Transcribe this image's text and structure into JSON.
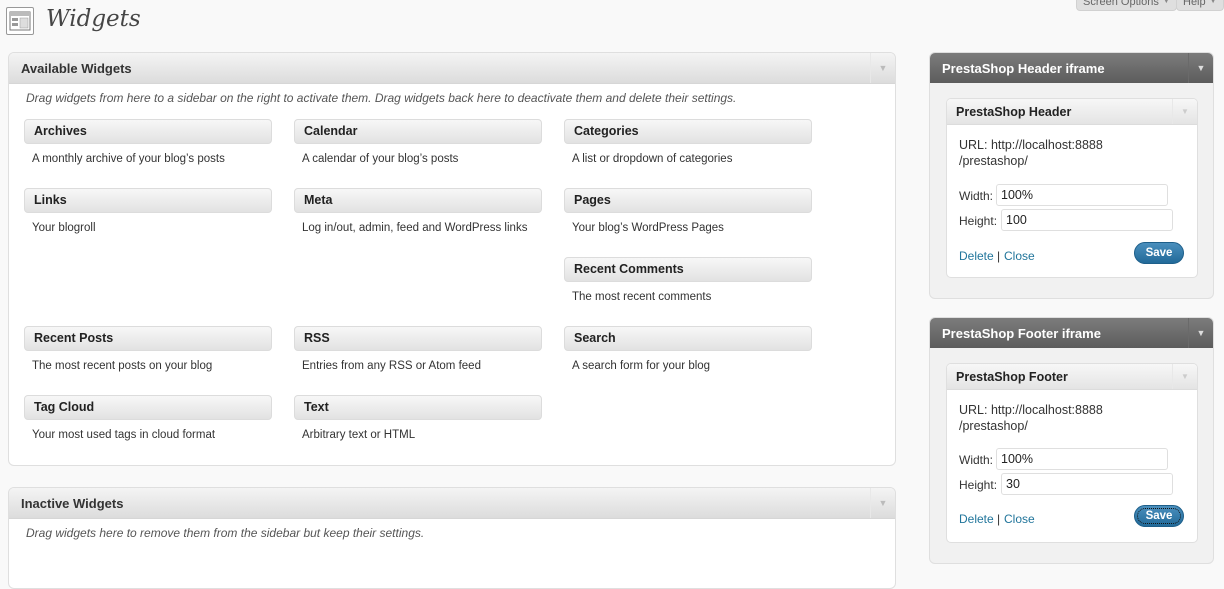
{
  "top_tabs": {
    "screen_options": "Screen Options",
    "help": "Help"
  },
  "page": {
    "title": "Widgets",
    "icon": "widgets-icon"
  },
  "available": {
    "title": "Available Widgets",
    "description": "Drag widgets from here to a sidebar on the right to activate them. Drag widgets back here to deactivate them and delete their settings.",
    "widgets": [
      {
        "title": "Archives",
        "desc": "A monthly archive of your blog’s posts"
      },
      {
        "title": "Calendar",
        "desc": "A calendar of your blog’s posts"
      },
      {
        "title": "Categories",
        "desc": "A list or dropdown of categories"
      },
      {
        "title": "Links",
        "desc": "Your blogroll"
      },
      {
        "title": "Meta",
        "desc": "Log in/out, admin, feed and WordPress links"
      },
      {
        "title": "Pages",
        "desc": "Your blog’s WordPress Pages"
      },
      {
        "title": "Recent Comments",
        "desc": "The most recent comments"
      },
      {
        "title": "Recent Posts",
        "desc": "The most recent posts on your blog"
      },
      {
        "title": "RSS",
        "desc": "Entries from any RSS or Atom feed"
      },
      {
        "title": "Search",
        "desc": "A search form for your blog"
      },
      {
        "title": "Tag Cloud",
        "desc": "Your most used tags in cloud format"
      },
      {
        "title": "Text",
        "desc": "Arbitrary text or HTML"
      }
    ]
  },
  "inactive": {
    "title": "Inactive Widgets",
    "description": "Drag widgets here to remove them from the sidebar but keep their settings."
  },
  "sidebars": [
    {
      "title": "PrestaShop Header iframe",
      "widget": {
        "title": "PrestaShop Header",
        "url_line1": "URL: http://localhost:8888",
        "url_line2": "/prestashop/",
        "width_label": "Width:",
        "width_value": "100%",
        "height_label": "Height:",
        "height_value": "100",
        "delete": "Delete",
        "separator": "|",
        "close": "Close",
        "save": "Save"
      }
    },
    {
      "title": "PrestaShop Footer iframe",
      "widget": {
        "title": "PrestaShop Footer",
        "url_line1": "URL: http://localhost:8888",
        "url_line2": "/prestashop/",
        "width_label": "Width:",
        "width_value": "100%",
        "height_label": "Height:",
        "height_value": "30",
        "delete": "Delete",
        "separator": "|",
        "close": "Close",
        "save": "Save"
      }
    }
  ]
}
